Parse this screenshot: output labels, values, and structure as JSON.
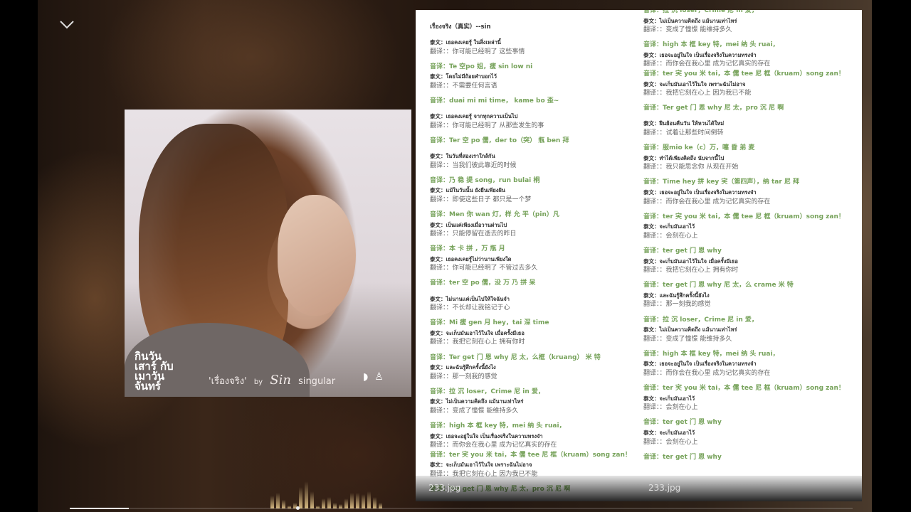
{
  "album_art": {
    "logo_text": "กินวัน เสาร์ กับเมาวัน จันทร์",
    "song_title": "'เรื่องจริง'",
    "by": "by",
    "artist_signature": "Sin",
    "label": "singular"
  },
  "playback": {
    "progress_percent": 7.5
  },
  "visualizer": {
    "levels": [
      0.45,
      0.55,
      0.3,
      0.1,
      0.2,
      0.75,
      0.95,
      0.6,
      0.1,
      0.35,
      0.4,
      0.2,
      0.15,
      0.35,
      0.55,
      0.55,
      0.5,
      0.6,
      0.4,
      0.2
    ]
  },
  "left_panel": {
    "filename": "233.jpg",
    "groups": [
      [
        {
          "k": "ttl",
          "t": "เรื่องจริง（真实）--sin"
        }
      ],
      [
        {
          "k": "thai",
          "t": "泰文：เธอคงเคยรู้ ในสิ่งเหล่านี้"
        },
        {
          "k": "trans",
          "t": "翻译：：你可能已经明了 这些事情"
        }
      ],
      [
        {
          "k": "yin",
          "t": "音译：Te 空po 姐，瘦 sin low ni"
        },
        {
          "k": "thai",
          "t": "泰文：โดยไม่มีถ้อยคำบอกไว้"
        },
        {
          "k": "trans",
          "t": "翻译：：不需要任何言语"
        }
      ],
      [
        {
          "k": "yin",
          "t": "音译：duai mi mi time， kame bo 歪~"
        }
      ],
      [
        {
          "k": "thai",
          "t": "泰文：เธอคงเคยรู้ จากทุกความเป็นไป"
        },
        {
          "k": "trans",
          "t": "翻译：：你可能已经明了 从那些发生的事"
        }
      ],
      [
        {
          "k": "yin",
          "t": "音译：Ter 空 po 儒，der to（突） 瓶 ben 拜"
        }
      ],
      [
        {
          "k": "thai",
          "t": "泰文：ในวันที่สองเราใกล้กัน"
        },
        {
          "k": "trans",
          "t": "翻译：：当我们彼此靠近的时候"
        }
      ],
      [
        {
          "k": "yin",
          "t": "音译：乃 稳 提 song，run bulai 桐"
        },
        {
          "k": "thai",
          "t": "泰文：แม้ในวันนั้น ยังยืนเพียงฝัน"
        },
        {
          "k": "trans",
          "t": "翻译：：即使这些日子 都只是一个梦"
        }
      ],
      [
        {
          "k": "yin",
          "t": "音译：Men 你 wan 灯，样 允 平（pin）凡"
        },
        {
          "k": "thai",
          "t": "泰文：เป็นแค่เพียงเมื่อวานผ่านไป"
        },
        {
          "k": "trans",
          "t": "翻译：：只能停留在逝去的昨日"
        }
      ],
      [
        {
          "k": "yin",
          "t": "音译：本 卡 拼 ，万 瓶 月"
        },
        {
          "k": "thai",
          "t": "泰文：เธอคงเคยรู้ไม่ว่านานเพียงใด"
        },
        {
          "k": "trans",
          "t": "翻译：：你可能已经明了 不管过去多久"
        }
      ],
      [
        {
          "k": "yin",
          "t": "音译：ter 空 po 儒，没 万 乃 拼 呆"
        }
      ],
      [
        {
          "k": "thai",
          "t": "泰文：ไม่นานแค่เป็นไปให้ใจฉันจำ"
        },
        {
          "k": "trans",
          "t": "翻译：：不长却让我铭记于心"
        }
      ],
      [
        {
          "k": "yin",
          "t": "音译：Mi 瘦 gen 月 hey，tai 深 time"
        },
        {
          "k": "thai",
          "t": "泰文：จะเก็บมันเอาไว้ในใจ เมื่อครั้งมีเธอ"
        },
        {
          "k": "trans",
          "t": "翻译：：我把它刻在心上 拥有你时"
        }
      ],
      [
        {
          "k": "yin",
          "t": "音译：Ter get 门 恩 why 尼 太，么框（kruang） 米 特"
        },
        {
          "k": "thai",
          "t": "泰文：และฉันรู้สึกครั้งนี้ยังไง"
        },
        {
          "k": "trans",
          "t": "翻译：：那一刻我的感觉"
        }
      ],
      [
        {
          "k": "yin",
          "t": "音译：拉 沉 loser，Crime 尼 in 爱，"
        },
        {
          "k": "thai",
          "t": "泰文：ไม่เป็นความคิดถึง แม้นานเท่าไหร่"
        },
        {
          "k": "trans",
          "t": "翻译：：变成了憧憬 能维持多久"
        }
      ],
      [
        {
          "k": "yin",
          "t": "音译：high 本 框 key 特，mei 纳 头 ruai，"
        },
        {
          "k": "thai",
          "t": "泰文：เธอจะอยู่ในใจ เป็นเรื่องจริงในความทรงจำ"
        },
        {
          "k": "trans",
          "t": "翻译：：而你会在我心里 成为记忆真实的存在"
        },
        {
          "k": "yin",
          "t": "音译：ter 宎 you 米 tai，本 儒 tee 尼 框（kruam）song zan！"
        },
        {
          "k": "thai",
          "t": "泰文：จะเก็บมันเอาไว้ในใจ เพราะฉันไม่อาจ"
        },
        {
          "k": "trans",
          "t": "翻译：：我把它刻在心上 因为我已不能"
        }
      ],
      [
        {
          "k": "yin",
          "t": "音译：Ter get 门 恩 why 尼 太，pro 沉 尼 啊"
        }
      ]
    ]
  },
  "right_panel": {
    "filename": "233.jpg",
    "groups": [
      [
        {
          "k": "yin",
          "t": "音译：拉 沉 loser，Crime 尼 in 爱，"
        },
        {
          "k": "thai",
          "t": "泰文：ไม่เป็นความคิดถึง แม้นานเท่าไหร่"
        },
        {
          "k": "trans",
          "t": "翻译：：变成了憧憬 能维持多久"
        }
      ],
      [
        {
          "k": "yin",
          "t": "音译：high 本 框 key 特，mei 纳 头 ruai，"
        },
        {
          "k": "thai",
          "t": "泰文：เธอจะอยู่ในใจ เป็นเรื่องจริงในความทรงจำ"
        },
        {
          "k": "trans",
          "t": "翻译：：而你会在我心里 成为记忆真实的存在"
        },
        {
          "k": "yin",
          "t": "音译：ter 宎 you 米 tai，本 儒 tee 尼 框（kruam）song zan！"
        },
        {
          "k": "thai",
          "t": "泰文：จะเก็บมันเอาไว้ในใจ เพราะฉันไม่อาจ"
        },
        {
          "k": "trans",
          "t": "翻译：：我把它刻在心上 因为我已不能"
        }
      ],
      [
        {
          "k": "yin",
          "t": "音译：Ter get 门 恩 why 尼 太，pro 沉 尼 啊"
        }
      ],
      [
        {
          "k": "thai",
          "t": "泰文：ฝืนย้อนคืนวัน ให้หวนได้ใหม่"
        },
        {
          "k": "trans",
          "t": "翻译：：试着让那些时间倒转"
        }
      ],
      [
        {
          "k": "yin",
          "t": "音译：服mio ke（c）万，噻 昏 弟 麦"
        },
        {
          "k": "thai",
          "t": "泰文：ทำได้เพียงคิดถึง นับจากนี้ไป"
        },
        {
          "k": "trans",
          "t": "翻译：：我只能思念你 从现在开始"
        }
      ],
      [
        {
          "k": "yin",
          "t": "音译：Time hey 拼 key 宎（第四声），纳 tar 尼 拜"
        },
        {
          "k": "thai",
          "t": "泰文：เธอจะอยู่ในใจ เป็นเรื่องจริงในความทรงจำ"
        },
        {
          "k": "trans",
          "t": "翻译：：而你会在我心里 成为记忆真实的存在"
        }
      ],
      [
        {
          "k": "yin",
          "t": "音译：ter 宎 you 米 tai，本 儒 tee 尼 框（kruam）song zan！"
        },
        {
          "k": "thai",
          "t": "泰文：จะเก็บมันเอาไว้"
        },
        {
          "k": "trans",
          "t": "翻译：：会刻在心上"
        }
      ],
      [
        {
          "k": "yin",
          "t": "音译：ter get 门 恩 why"
        },
        {
          "k": "thai",
          "t": "泰文：จะเก็บมันเอาไว้ในใจ เมื่อครั้งมีเธอ"
        },
        {
          "k": "trans",
          "t": "翻译：：我把它刻在心上 拥有你时"
        }
      ],
      [
        {
          "k": "yin",
          "t": "音译：ter get 门 恩 why 尼 太，么 crame 米 特"
        },
        {
          "k": "thai",
          "t": "泰文：และฉันรู้สึกครั้งนี้ยังไง"
        },
        {
          "k": "trans",
          "t": "翻译：：那一刻我的感觉"
        }
      ],
      [
        {
          "k": "yin",
          "t": "音译：拉 沉 loser，Crime 尼 in 爱，"
        },
        {
          "k": "thai",
          "t": "泰文：ไม่เป็นความคิดถึง แม้นานเท่าไหร่"
        },
        {
          "k": "trans",
          "t": "翻译：：变成了憧憬 能维持多久"
        }
      ],
      [
        {
          "k": "yin",
          "t": "音译：high 本 框 key 特，mei 纳 头 ruai，"
        },
        {
          "k": "thai",
          "t": "泰文：เธอจะอยู่ในใจ เป็นเรื่องจริงในความทรงจำ"
        },
        {
          "k": "trans",
          "t": "翻译：：而你会在我心里 成为记忆真实的存在"
        }
      ],
      [
        {
          "k": "yin",
          "t": "音译：ter 宎 you 米 tai，本 儒 tee 尼 框（kruam）song zan！"
        },
        {
          "k": "thai",
          "t": "泰文：จะเก็บมันเอาไว้"
        },
        {
          "k": "trans",
          "t": "翻译：：会刻在心上"
        }
      ],
      [
        {
          "k": "yin",
          "t": "音译：ter get 门 恩 why"
        },
        {
          "k": "thai",
          "t": "泰文：จะเก็บมันเอาไว้"
        },
        {
          "k": "trans",
          "t": "翻译：：会刻在心上"
        }
      ],
      [
        {
          "k": "yin",
          "t": "音译：ter get 门 恩 why"
        }
      ]
    ]
  }
}
